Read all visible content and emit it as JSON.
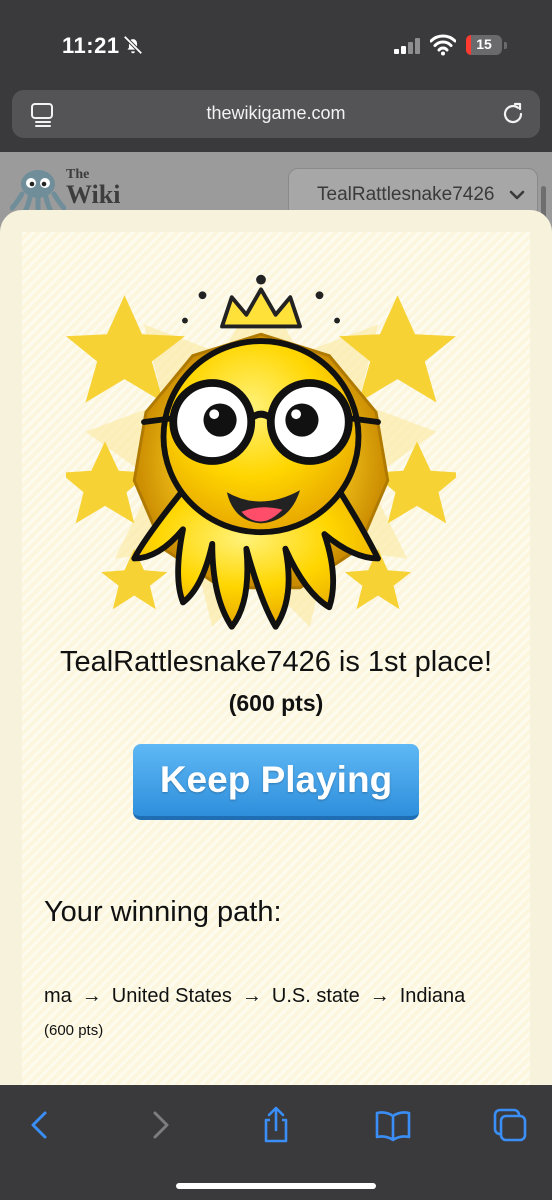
{
  "status": {
    "time": "11:21",
    "battery": "15",
    "battery_level": 0.15
  },
  "browser": {
    "url": "thewikigame.com"
  },
  "background_page": {
    "logo_the": "The",
    "logo_wiki": "Wiki",
    "username": "TealRattlesnake7426"
  },
  "modal": {
    "winner_message": "TealRattlesnake7426 is 1st place!",
    "points": "(600 pts)",
    "keep_playing_label": "Keep Playing",
    "path_heading": "Your winning path:",
    "path": [
      "ma",
      "United States",
      "U.S. state",
      "Indiana"
    ],
    "path_arrow": "→",
    "path_points": "(600 pts)"
  },
  "colors": {
    "accent_button": "#3a9be6",
    "modal_bg": "#fbf6dd",
    "toolbar_icons": "#3a8ef6"
  },
  "icons": [
    "bell-slash-icon",
    "signal-icon",
    "wifi-icon",
    "reader-icon",
    "reload-icon",
    "back-icon",
    "forward-icon",
    "share-icon",
    "bookmarks-icon",
    "tabs-icon",
    "chevron-down-icon",
    "mascot-image"
  ]
}
